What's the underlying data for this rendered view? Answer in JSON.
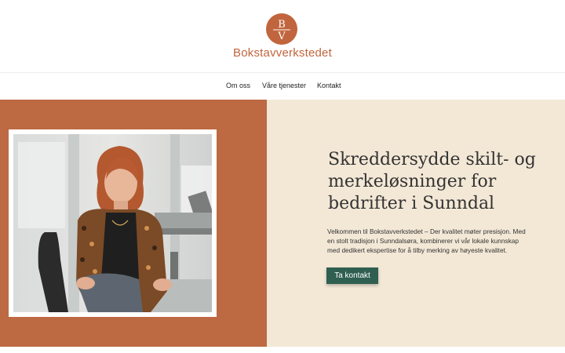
{
  "brand": {
    "monogram_top": "B",
    "monogram_bottom": "V",
    "name": "Bokstavverkstedet"
  },
  "nav": {
    "items": [
      {
        "label": "Om oss"
      },
      {
        "label": "Våre tjenester"
      },
      {
        "label": "Kontakt"
      }
    ]
  },
  "hero": {
    "title": "Skreddersydde skilt- og merkeløsninger for bedrifter i Sunndal",
    "body": "Velkommen til Bokstavverkstedet – Der kvalitet møter presisjon. Med en stolt tradisjon i Sunndalsøra, kombinerer vi vår lokale kunnskap med dedikert ekspertise for å tilby merking av høyeste kvalitet.",
    "cta_label": "Ta kontakt"
  },
  "colors": {
    "brand": "#c0653d",
    "hero_left_bg": "#bd6942",
    "hero_right_bg": "#f3e8d6",
    "cta_bg": "#2f5f50"
  }
}
